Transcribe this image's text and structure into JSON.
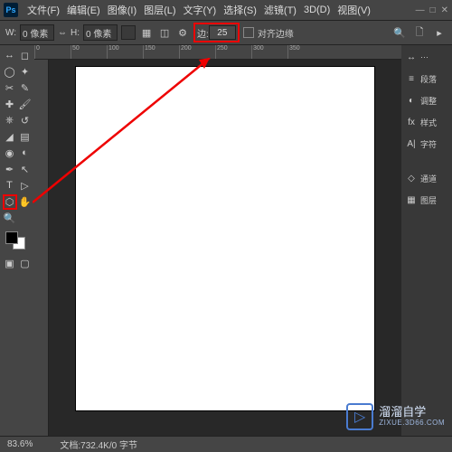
{
  "menubar": {
    "items": [
      "文件(F)",
      "编辑(E)",
      "图像(I)",
      "图层(L)",
      "文字(Y)",
      "选择(S)",
      "滤镜(T)",
      "3D(D)",
      "视图(V)"
    ]
  },
  "optbar": {
    "w_label": "W:",
    "w_value": "0 像素",
    "link": "⇔",
    "h_label": "H:",
    "h_value": "0 像素",
    "sides_label": "边:",
    "sides_value": "25",
    "align_label": "对齐边缘"
  },
  "panels": {
    "items": [
      {
        "icon": "↔",
        "label": "···"
      },
      {
        "icon": "≡",
        "label": "段落"
      },
      {
        "icon": "◐",
        "label": "调整"
      },
      {
        "icon": "fx",
        "label": "样式"
      },
      {
        "icon": "A|",
        "label": "字符"
      },
      {
        "icon": "◇",
        "label": "通道"
      },
      {
        "icon": "▦",
        "label": "图层"
      }
    ]
  },
  "ruler": [
    "0",
    "50",
    "100",
    "150",
    "200",
    "250",
    "300",
    "350"
  ],
  "status": {
    "zoom": "83.6%",
    "doc": "文档:732.4K/0 字节"
  },
  "watermark": {
    "name": "溜溜自学",
    "url": "ZIXUE.3D66.COM"
  }
}
